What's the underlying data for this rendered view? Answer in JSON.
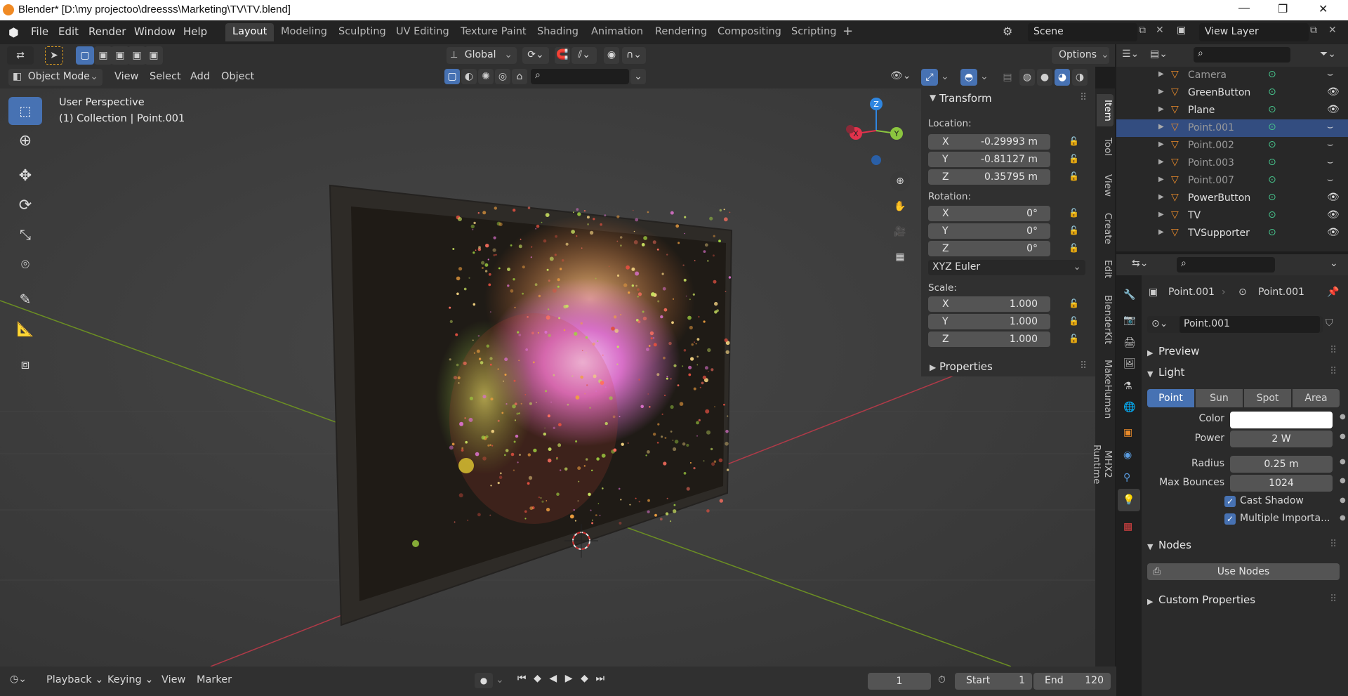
{
  "window": {
    "title": "Blender* [D:\\my projectoo\\dreesss\\Marketing\\TV\\TV.blend]"
  },
  "menu": {
    "items": [
      "File",
      "Edit",
      "Render",
      "Window",
      "Help"
    ]
  },
  "workspaces": [
    "Layout",
    "Modeling",
    "Sculpting",
    "UV Editing",
    "Texture Paint",
    "Shading",
    "Animation",
    "Rendering",
    "Compositing",
    "Scripting"
  ],
  "scene": {
    "name": "Scene",
    "view_layer": "View Layer"
  },
  "toolheader": {
    "orientation": "Global",
    "options": "Options"
  },
  "viewport_header": {
    "mode": "Object Mode",
    "menus": [
      "View",
      "Select",
      "Add",
      "Object"
    ]
  },
  "viewport": {
    "perspective": "User Perspective",
    "collection": "(1) Collection | Point.001"
  },
  "npanel": {
    "transform_title": "Transform",
    "location_label": "Location:",
    "location": [
      {
        "axis": "X",
        "value": "-0.29993 m"
      },
      {
        "axis": "Y",
        "value": "-0.81127 m"
      },
      {
        "axis": "Z",
        "value": "0.35795 m"
      }
    ],
    "rotation_label": "Rotation:",
    "rotation": [
      {
        "axis": "X",
        "value": "0°"
      },
      {
        "axis": "Y",
        "value": "0°"
      },
      {
        "axis": "Z",
        "value": "0°"
      }
    ],
    "rotation_mode": "XYZ Euler",
    "scale_label": "Scale:",
    "scale": [
      {
        "axis": "X",
        "value": "1.000"
      },
      {
        "axis": "Y",
        "value": "1.000"
      },
      {
        "axis": "Z",
        "value": "1.000"
      }
    ],
    "properties_title": "Properties"
  },
  "vtabs": [
    "Item",
    "Tool",
    "View",
    "Create",
    "Edit",
    "BlenderKit",
    "MakeHuman",
    "MHX2 Runtime"
  ],
  "outliner": {
    "rows": [
      {
        "name": "Camera",
        "dim": true,
        "selected": false
      },
      {
        "name": "GreenButton",
        "dim": false,
        "selected": false
      },
      {
        "name": "Plane",
        "dim": false,
        "selected": false
      },
      {
        "name": "Point.001",
        "dim": true,
        "selected": true
      },
      {
        "name": "Point.002",
        "dim": true,
        "selected": false
      },
      {
        "name": "Point.003",
        "dim": true,
        "selected": false
      },
      {
        "name": "Point.007",
        "dim": true,
        "selected": false
      },
      {
        "name": "PowerButton",
        "dim": false,
        "selected": false
      },
      {
        "name": "TV",
        "dim": false,
        "selected": false
      },
      {
        "name": "TVSupporter",
        "dim": false,
        "selected": false
      }
    ]
  },
  "properties": {
    "breadcrumb_object": "Point.001",
    "breadcrumb_data": "Point.001",
    "datablock_name": "Point.001",
    "preview_label": "Preview",
    "light_label": "Light",
    "light_types": [
      "Point",
      "Sun",
      "Spot",
      "Area"
    ],
    "active_light_type": "Point",
    "color_label": "Color",
    "power_label": "Power",
    "power_value": "2 W",
    "radius_label": "Radius",
    "radius_value": "0.25 m",
    "max_bounces_label": "Max Bounces",
    "max_bounces_value": "1024",
    "cast_shadow_label": "Cast Shadow",
    "multiple_importance_label": "Multiple Importa...",
    "nodes_label": "Nodes",
    "use_nodes_label": "Use Nodes",
    "custom_props_label": "Custom Properties"
  },
  "timeline": {
    "menus": [
      "Playback",
      "Keying",
      "View",
      "Marker"
    ],
    "current_frame": "1",
    "start_label": "Start",
    "start_value": "1",
    "end_label": "End",
    "end_value": "120"
  },
  "colors": {
    "accent": "#4772b3",
    "outliner_selected": "#334d80",
    "axis_x": "#e2324c",
    "axis_y": "#8bc53f",
    "axis_z": "#2f86e0"
  }
}
